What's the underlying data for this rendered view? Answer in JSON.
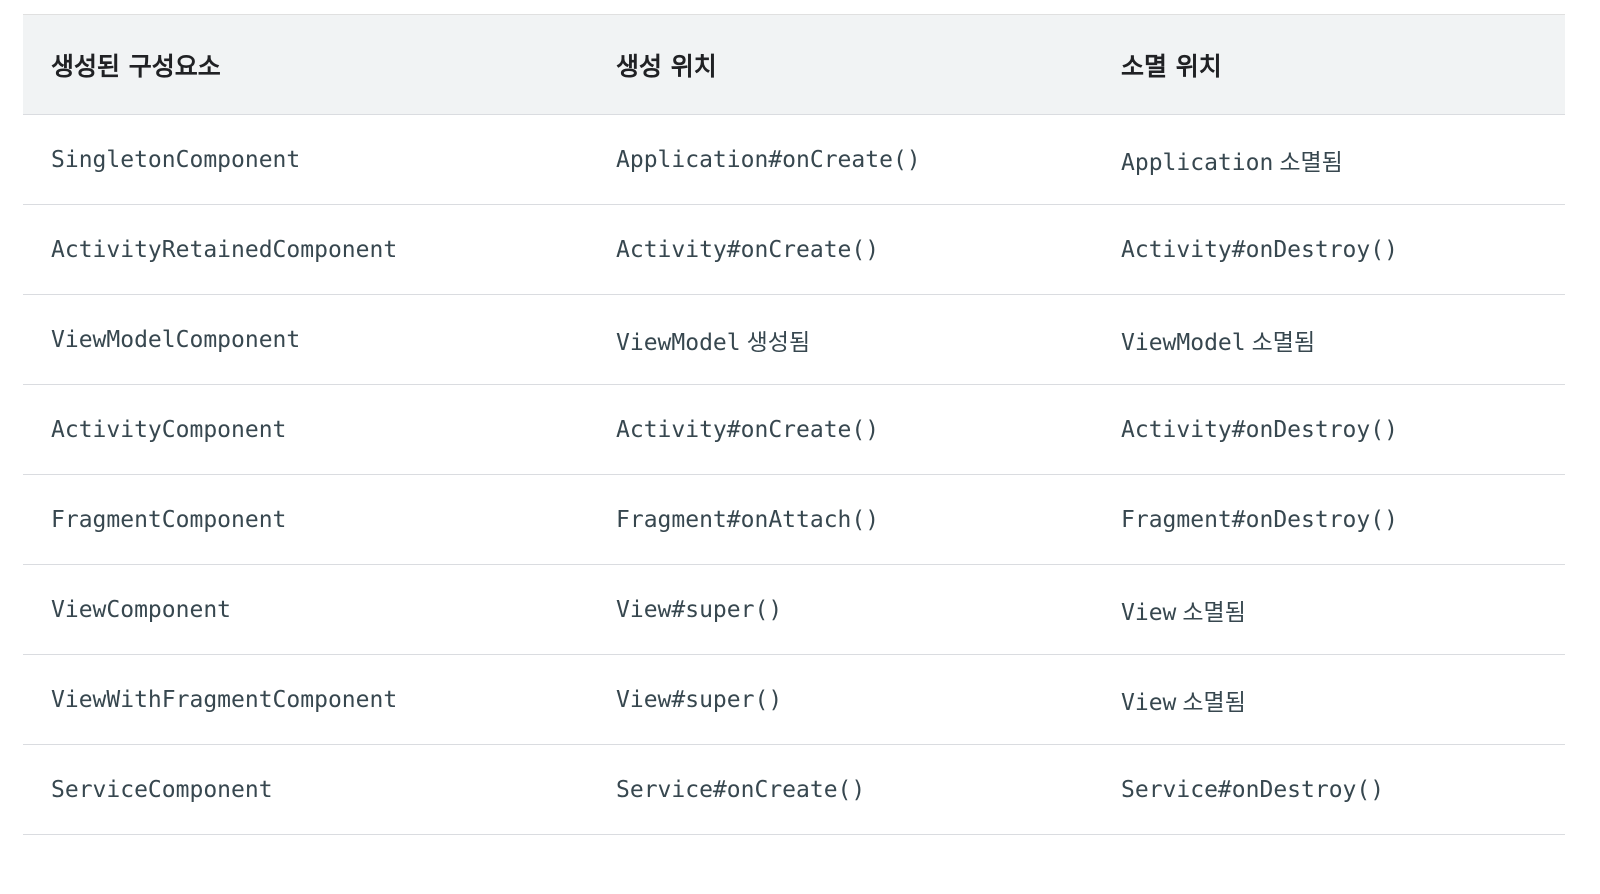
{
  "table": {
    "headers": [
      "생성된 구성요소",
      "생성 위치",
      "소멸 위치"
    ],
    "rows": [
      {
        "component": "SingletonComponent",
        "created_code": "Application#onCreate()",
        "created_text": "",
        "destroyed_code": "Application",
        "destroyed_text": "소멸됨"
      },
      {
        "component": "ActivityRetainedComponent",
        "created_code": "Activity#onCreate()",
        "created_text": "",
        "destroyed_code": "Activity#onDestroy()",
        "destroyed_text": ""
      },
      {
        "component": "ViewModelComponent",
        "created_code": "ViewModel",
        "created_text": "생성됨",
        "destroyed_code": "ViewModel",
        "destroyed_text": "소멸됨"
      },
      {
        "component": "ActivityComponent",
        "created_code": "Activity#onCreate()",
        "created_text": "",
        "destroyed_code": "Activity#onDestroy()",
        "destroyed_text": ""
      },
      {
        "component": "FragmentComponent",
        "created_code": "Fragment#onAttach()",
        "created_text": "",
        "destroyed_code": "Fragment#onDestroy()",
        "destroyed_text": ""
      },
      {
        "component": "ViewComponent",
        "created_code": "View#super()",
        "created_text": "",
        "destroyed_code": "View",
        "destroyed_text": "소멸됨"
      },
      {
        "component": "ViewWithFragmentComponent",
        "created_code": "View#super()",
        "created_text": "",
        "destroyed_code": "View",
        "destroyed_text": "소멸됨"
      },
      {
        "component": "ServiceComponent",
        "created_code": "Service#onCreate()",
        "created_text": "",
        "destroyed_code": "Service#onDestroy()",
        "destroyed_text": ""
      }
    ]
  }
}
